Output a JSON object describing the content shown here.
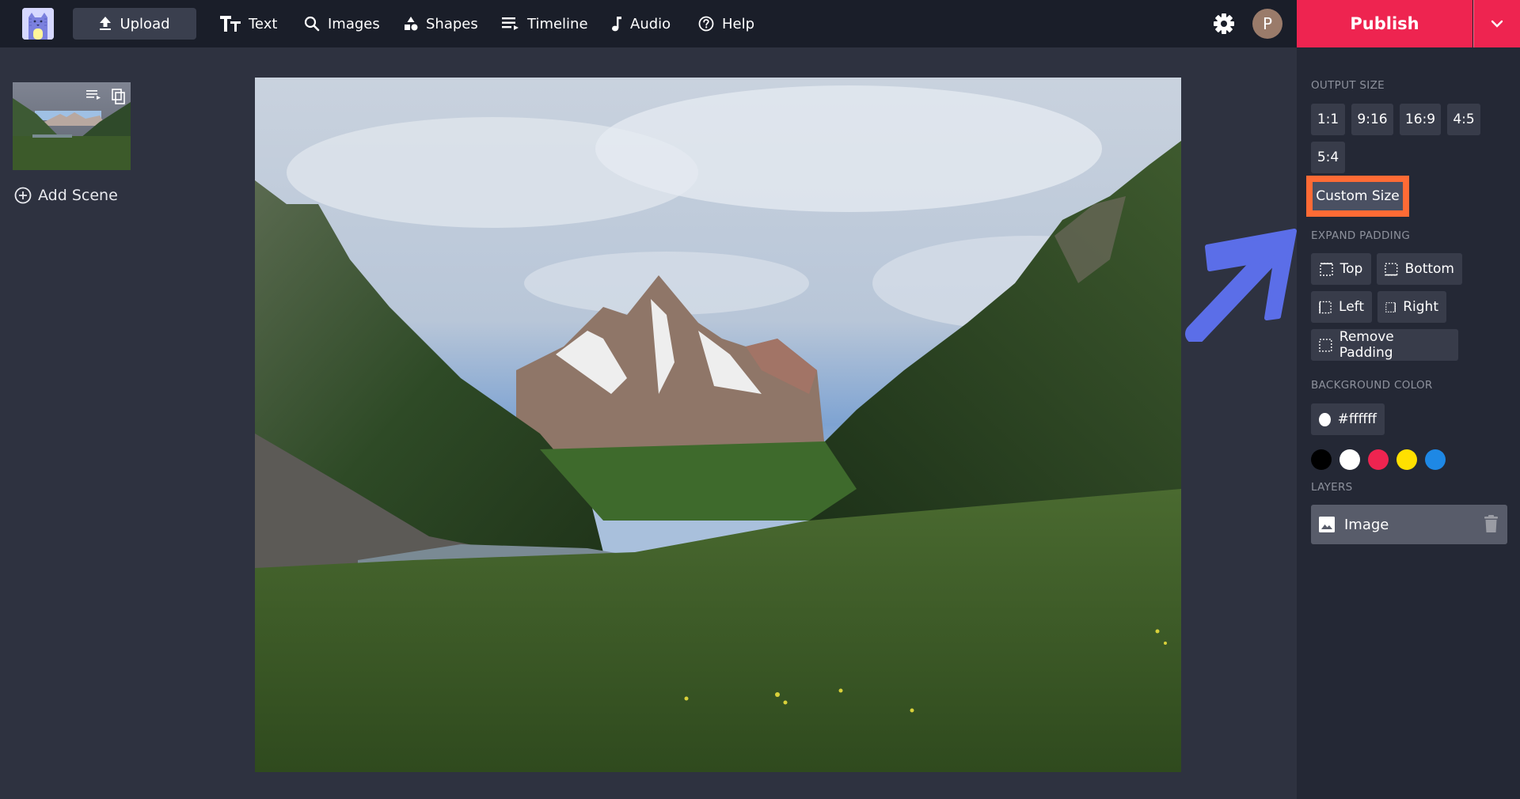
{
  "topbar": {
    "logo_icon": "cat-logo-icon",
    "upload_label": "Upload",
    "nav": [
      {
        "label": "Text",
        "icon": "text-icon"
      },
      {
        "label": "Images",
        "icon": "search-icon"
      },
      {
        "label": "Shapes",
        "icon": "shapes-icon"
      },
      {
        "label": "Timeline",
        "icon": "timeline-icon"
      },
      {
        "label": "Audio",
        "icon": "music-note-icon"
      },
      {
        "label": "Help",
        "icon": "help-circle-icon"
      }
    ],
    "avatar_initial": "P",
    "publish_label": "Publish"
  },
  "scenes": {
    "add_scene_label": "Add Scene"
  },
  "right_panel": {
    "output_size": {
      "label": "OUTPUT SIZE",
      "options": [
        "1:1",
        "9:16",
        "16:9",
        "4:5",
        "5:4"
      ],
      "custom_label": "Custom Size"
    },
    "expand_padding": {
      "label": "EXPAND PADDING",
      "options": [
        "Top",
        "Bottom",
        "Left",
        "Right"
      ],
      "remove_label": "Remove Padding"
    },
    "background_color": {
      "label": "BACKGROUND COLOR",
      "current": "#ffffff",
      "swatches": [
        "#000000",
        "#ffffff",
        "#ee2450",
        "#ffe000",
        "#1e88e5"
      ]
    },
    "layers": {
      "label": "LAYERS",
      "items": [
        {
          "name": "Image"
        }
      ]
    }
  },
  "colors": {
    "accent": "#ee2450",
    "highlight": "#ff6b35",
    "annotation_arrow": "#5b6ee8"
  }
}
